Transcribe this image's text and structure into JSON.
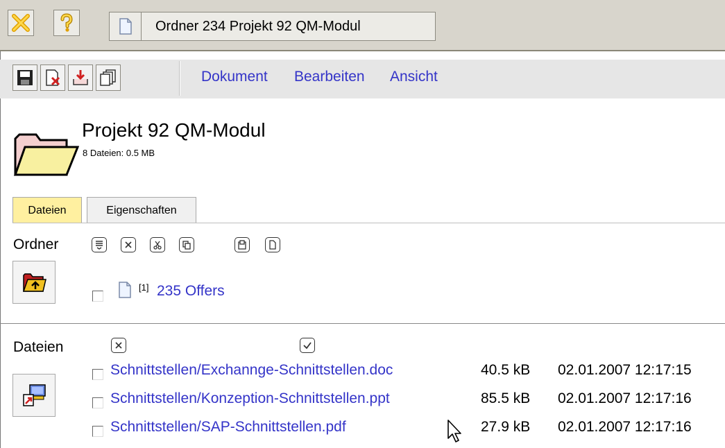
{
  "window": {
    "title_tab": "Ordner 234 Projekt 92 QM-Modul"
  },
  "icons": {
    "close": "close-x-icon",
    "help": "question-icon",
    "doc": "document-icon",
    "save": "floppy-disk-icon",
    "delete": "delete-document-icon",
    "download": "download-tray-icon",
    "copy": "copy-pages-icon",
    "folder": "open-folder-icon",
    "folder_up": "folder-up-icon",
    "upload": "upload-file-icon"
  },
  "menu": {
    "items": [
      "Dokument",
      "Bearbeiten",
      "Ansicht"
    ]
  },
  "header": {
    "title": "Projekt 92 QM-Modul",
    "subtitle": "8 Dateien: 0.5 MB"
  },
  "tabs": [
    {
      "label": "Dateien",
      "active": true
    },
    {
      "label": "Eigenschaften",
      "active": false
    }
  ],
  "ordner": {
    "label": "Ordner",
    "items": [
      {
        "marker": "[1]",
        "name": "235 Offers"
      }
    ]
  },
  "dateien": {
    "label": "Dateien",
    "files": [
      {
        "name": "Schnittstellen/Exchannge-Schnittstellen.doc",
        "size": "40.5 kB",
        "date": "02.01.2007 12:17:15"
      },
      {
        "name": "Schnittstellen/Konzeption-Schnittstellen.ppt",
        "size": "85.5 kB",
        "date": "02.01.2007 12:17:16"
      },
      {
        "name": "Schnittstellen/SAP-Schnittstellen.pdf",
        "size": "27.9 kB",
        "date": "02.01.2007 12:17:16"
      }
    ]
  },
  "colors": {
    "link": "#3434c8",
    "active_tab": "#fff0a0",
    "titlebar": "#d8d5cc",
    "toolbar": "#e6e6e6"
  }
}
